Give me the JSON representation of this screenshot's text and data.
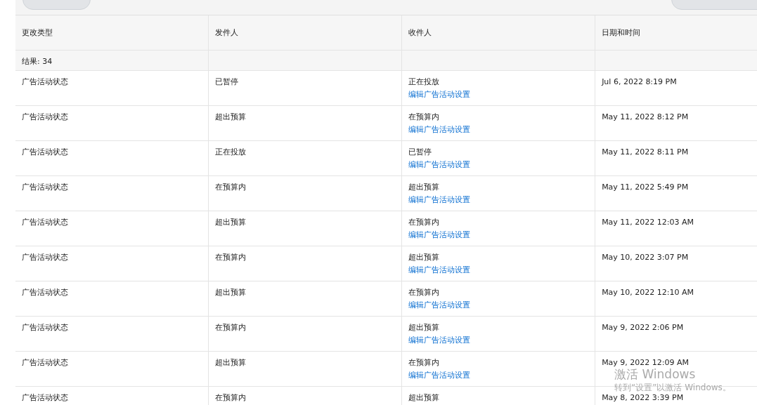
{
  "table": {
    "columns": [
      "更改类型",
      "发件人",
      "收件人",
      "日期和时间"
    ],
    "summary": "结果: 34",
    "rows": [
      {
        "type": "广告活动状态",
        "from": "已暂停",
        "to": "正在投放",
        "link": "编辑广告活动设置",
        "date": "Jul 6, 2022 8:19 PM"
      },
      {
        "type": "广告活动状态",
        "from": "超出预算",
        "to": "在预算内",
        "link": "编辑广告活动设置",
        "date": "May 11, 2022 8:12 PM"
      },
      {
        "type": "广告活动状态",
        "from": "正在投放",
        "to": "已暂停",
        "link": "编辑广告活动设置",
        "date": "May 11, 2022 8:11 PM"
      },
      {
        "type": "广告活动状态",
        "from": "在预算内",
        "to": "超出预算",
        "link": "编辑广告活动设置",
        "date": "May 11, 2022 5:49 PM"
      },
      {
        "type": "广告活动状态",
        "from": "超出预算",
        "to": "在预算内",
        "link": "编辑广告活动设置",
        "date": "May 11, 2022 12:03 AM"
      },
      {
        "type": "广告活动状态",
        "from": "在预算内",
        "to": "超出预算",
        "link": "编辑广告活动设置",
        "date": "May 10, 2022 3:07 PM"
      },
      {
        "type": "广告活动状态",
        "from": "超出预算",
        "to": "在预算内",
        "link": "编辑广告活动设置",
        "date": "May 10, 2022 12:10 AM"
      },
      {
        "type": "广告活动状态",
        "from": "在预算内",
        "to": "超出预算",
        "link": "编辑广告活动设置",
        "date": "May 9, 2022 2:06 PM"
      },
      {
        "type": "广告活动状态",
        "from": "超出预算",
        "to": "在预算内",
        "link": "编辑广告活动设置",
        "date": "May 9, 2022 12:09 AM"
      },
      {
        "type": "广告活动状态",
        "from": "在预算内",
        "to": "超出预算",
        "date": "May 8, 2022 3:39 PM"
      }
    ]
  },
  "os_notice": {
    "title": "激活 Windows",
    "message": "转到“设置”以激活 Windows。"
  }
}
